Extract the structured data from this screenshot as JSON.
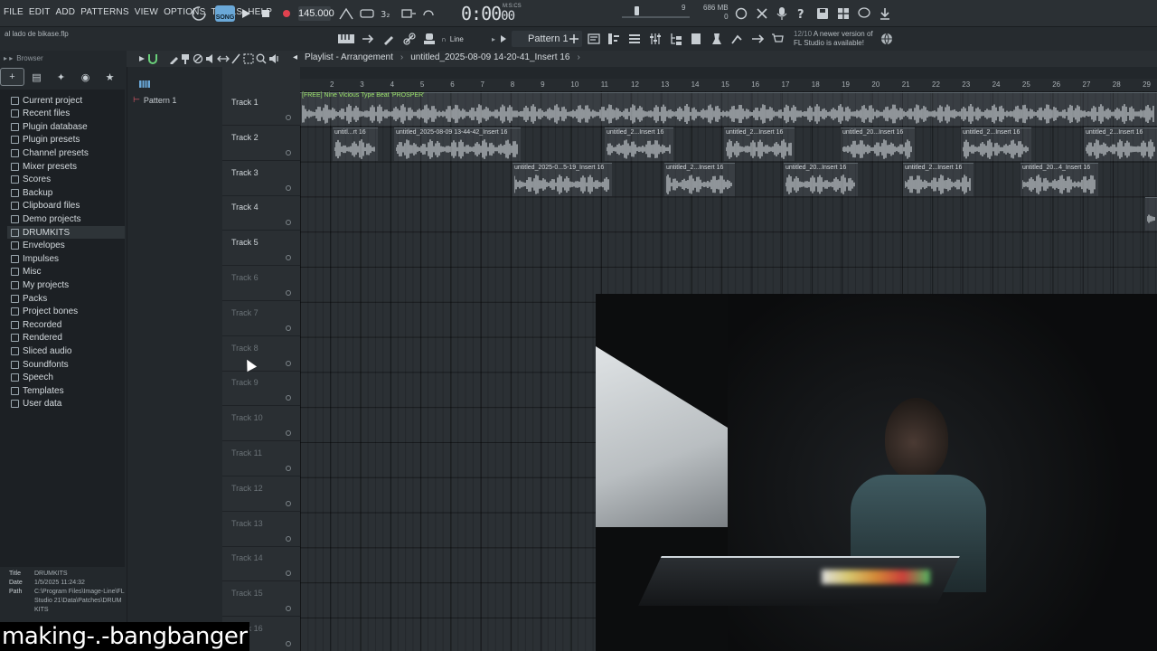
{
  "menu": [
    "FILE",
    "EDIT",
    "ADD",
    "PATTERNS",
    "VIEW",
    "OPTIONS",
    "TOOLS",
    "HELP"
  ],
  "transport": {
    "song_mode_label": "SONG",
    "tempo": "145.000",
    "time": "0:00",
    "time_sub": "00",
    "time_unit": "M:S:CS"
  },
  "status": {
    "cpu_value": "9",
    "memory": "686 MB",
    "voices": "0"
  },
  "toolbar2": {
    "project_name": "al lado de bikase.flp",
    "snap": "Line",
    "pattern": "Pattern 1",
    "update_version": "12/10",
    "update_text_1": "A newer version of",
    "update_text_2": "FL Studio is available!"
  },
  "browser": {
    "title": "Browser",
    "items": [
      "Current project",
      "Recent files",
      "Plugin database",
      "Plugin presets",
      "Channel presets",
      "Mixer presets",
      "Scores",
      "Backup",
      "Clipboard files",
      "Demo projects",
      "DRUMKITS",
      "Envelopes",
      "Impulses",
      "Misc",
      "My projects",
      "Packs",
      "Project bones",
      "Recorded",
      "Rendered",
      "Sliced audio",
      "Soundfonts",
      "Speech",
      "Templates",
      "User data"
    ],
    "selected_index": 10,
    "info": {
      "title_label": "Title",
      "title_value": "DRUMKITS",
      "date_label": "Date",
      "date_value": "1/5/2025 11:24:32",
      "path_label": "Path",
      "path_value": "C:\\Program Files\\Image-Line\\FL Studio 21\\Data\\Patches\\DRUMKITS"
    }
  },
  "picker": {
    "pattern": "Pattern 1"
  },
  "playlist": {
    "title": "Playlist - Arrangement",
    "clip_name": "untitled_2025-08-09 14-20-41_Insert 16",
    "pattern_clip": "[FREE] Nine Vicious Type Beat 'PROSPER'",
    "bars": [
      "2",
      "3",
      "4",
      "5",
      "6",
      "7",
      "8",
      "9",
      "10",
      "11",
      "12",
      "13",
      "14",
      "15",
      "16",
      "17",
      "18",
      "19",
      "20",
      "21",
      "22",
      "23",
      "24",
      "25",
      "26",
      "27",
      "28",
      "29"
    ],
    "tracks": [
      "Track 1",
      "Track 2",
      "Track 3",
      "Track 4",
      "Track 5",
      "Track 6",
      "Track 7",
      "Track 8",
      "Track 9",
      "Track 10",
      "Track 11",
      "Track 12",
      "Track 13",
      "Track 14",
      "Track 15",
      "Track 16"
    ],
    "track2_clips": [
      "untitl...rt 16",
      "untitled_2025-08-09 13-44-42_Insert 16",
      "untitled_2...Insert 16",
      "untitled_2...Insert 16",
      "untitled_20...Insert 16",
      "untitled_2...Insert 16",
      "untitled_2...Insert 16"
    ],
    "track3_clips": [
      "untitled_2025-0...5-19_Insert 16",
      "untitled_2...Insert 16",
      "untitled_20...Insert 16",
      "untitled_2...Insert 16",
      "untitled_20...4_Insert 16"
    ]
  },
  "caption": "making-.-bangbanger"
}
